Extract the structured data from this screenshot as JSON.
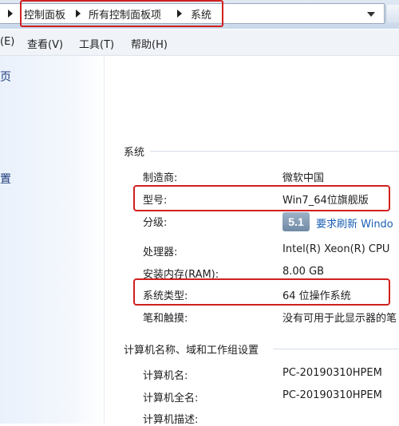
{
  "address_bar": {
    "breadcrumbs": [
      "控制面板",
      "所有控制面板项",
      "系统"
    ]
  },
  "menu": {
    "items": [
      "(E)",
      "查看(V)",
      "工具(T)",
      "帮助(H)"
    ]
  },
  "nav": {
    "items": [
      "页",
      "置"
    ]
  },
  "system_section": {
    "title": "系统",
    "rows": [
      {
        "label": "制造商:",
        "value": "微软中国"
      },
      {
        "label": "型号:",
        "value": "Win7_64位旗舰版"
      },
      {
        "label": "分级:",
        "value": ""
      },
      {
        "label": "处理器:",
        "value": "Intel(R) Xeon(R) CPU"
      },
      {
        "label": "安装内存(RAM):",
        "value": "8.00 GB"
      },
      {
        "label": "系统类型:",
        "value": "64 位操作系统"
      },
      {
        "label": "笔和触摸:",
        "value": "没有可用于此显示器的笔"
      }
    ],
    "rating": {
      "badge": "5.1",
      "link": "要求刷新 Windo"
    }
  },
  "computer_section": {
    "title": "计算机名称、域和工作组设置",
    "rows": [
      {
        "label": "计算机名:",
        "value": "PC-20190310HPEM"
      },
      {
        "label": "计算机全名:",
        "value": "PC-20190310HPEM"
      },
      {
        "label": "计算机描述:",
        "value": ""
      }
    ]
  },
  "colors": {
    "highlight": "#d0201f",
    "link": "#1a5fb4"
  }
}
